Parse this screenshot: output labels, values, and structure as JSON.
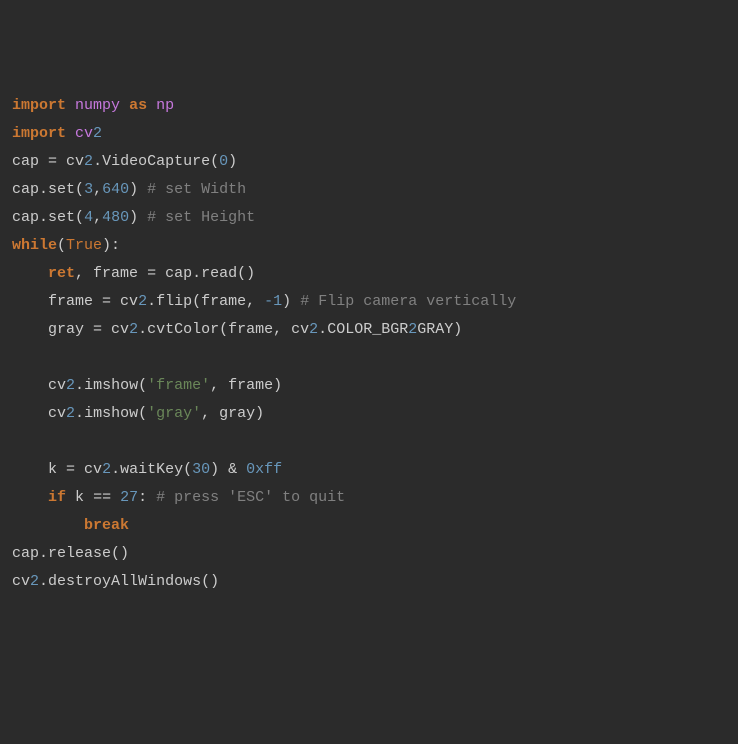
{
  "code": {
    "l1": {
      "import": "import",
      "numpy": "numpy",
      "as": "as",
      "np": "np"
    },
    "l2": {
      "import": "import",
      "cv": "cv",
      "two": "2"
    },
    "l3": {
      "cap": "cap",
      "eq": " = ",
      "cv": "cv",
      "two": "2",
      "dot": ".",
      "fn": "VideoCapture",
      "op": "(",
      "n": "0",
      "cp": ")"
    },
    "l4": {
      "cap": "cap",
      "dot": ".",
      "fn": "set",
      "op": "(",
      "a": "3",
      "c": ",",
      "b": "640",
      "cp": ")",
      "sp": " ",
      "com": "# set Width"
    },
    "l5": {
      "cap": "cap",
      "dot": ".",
      "fn": "set",
      "op": "(",
      "a": "4",
      "c": ",",
      "b": "480",
      "cp": ")",
      "sp": " ",
      "com": "# set Height"
    },
    "l6": {
      "kw": "while",
      "op": "(",
      "true": "True",
      "cp": "):"
    },
    "l7": {
      "ret": "ret",
      "c": ", ",
      "frame": "frame",
      "eq": " = ",
      "cap": "cap",
      "dot": ".",
      "fn": "read",
      "p": "()"
    },
    "l8": {
      "frame": "frame",
      "eq": " = ",
      "cv": "cv",
      "two": "2",
      "dot": ".",
      "fn": "flip",
      "op": "(",
      "arg": "frame, ",
      "n": "-1",
      "cp": ")",
      "sp": " ",
      "com": "# Flip camera vertically"
    },
    "l9": {
      "gray": "gray",
      "eq": " = ",
      "cv": "cv",
      "two": "2",
      "dot": ".",
      "fn": "cvtColor",
      "op": "(",
      "arg": "frame, ",
      "cv2": "cv",
      "two2": "2",
      "dot2": ".",
      "c1": "COLOR_BGR",
      "two3": "2",
      "c2": "GRAY",
      "cp": ")"
    },
    "l11": {
      "cv": "cv",
      "two": "2",
      "dot": ".",
      "fn": "imshow",
      "op": "(",
      "s": "'frame'",
      "c": ", ",
      "arg": "frame",
      "cp": ")"
    },
    "l12": {
      "cv": "cv",
      "two": "2",
      "dot": ".",
      "fn": "imshow",
      "op": "(",
      "s": "'gray'",
      "c": ", ",
      "arg": "gray",
      "cp": ")"
    },
    "l14": {
      "k": "k",
      "eq": " = ",
      "cv": "cv",
      "two": "2",
      "dot": ".",
      "fn": "waitKey",
      "op": "(",
      "n": "30",
      "cp": ")",
      "amp": " & ",
      "hex": "0xff"
    },
    "l15": {
      "if": "if",
      "sp": " ",
      "k": "k",
      "eq": " == ",
      "n": "27",
      "col": ": ",
      "com": "# press 'ESC' to quit"
    },
    "l16": {
      "break": "break"
    },
    "l17": {
      "cap": "cap",
      "dot": ".",
      "fn": "release",
      "p": "()"
    },
    "l18": {
      "cv": "cv",
      "two": "2",
      "dot": ".",
      "fn": "destroyAllWindows",
      "p": "()"
    }
  }
}
